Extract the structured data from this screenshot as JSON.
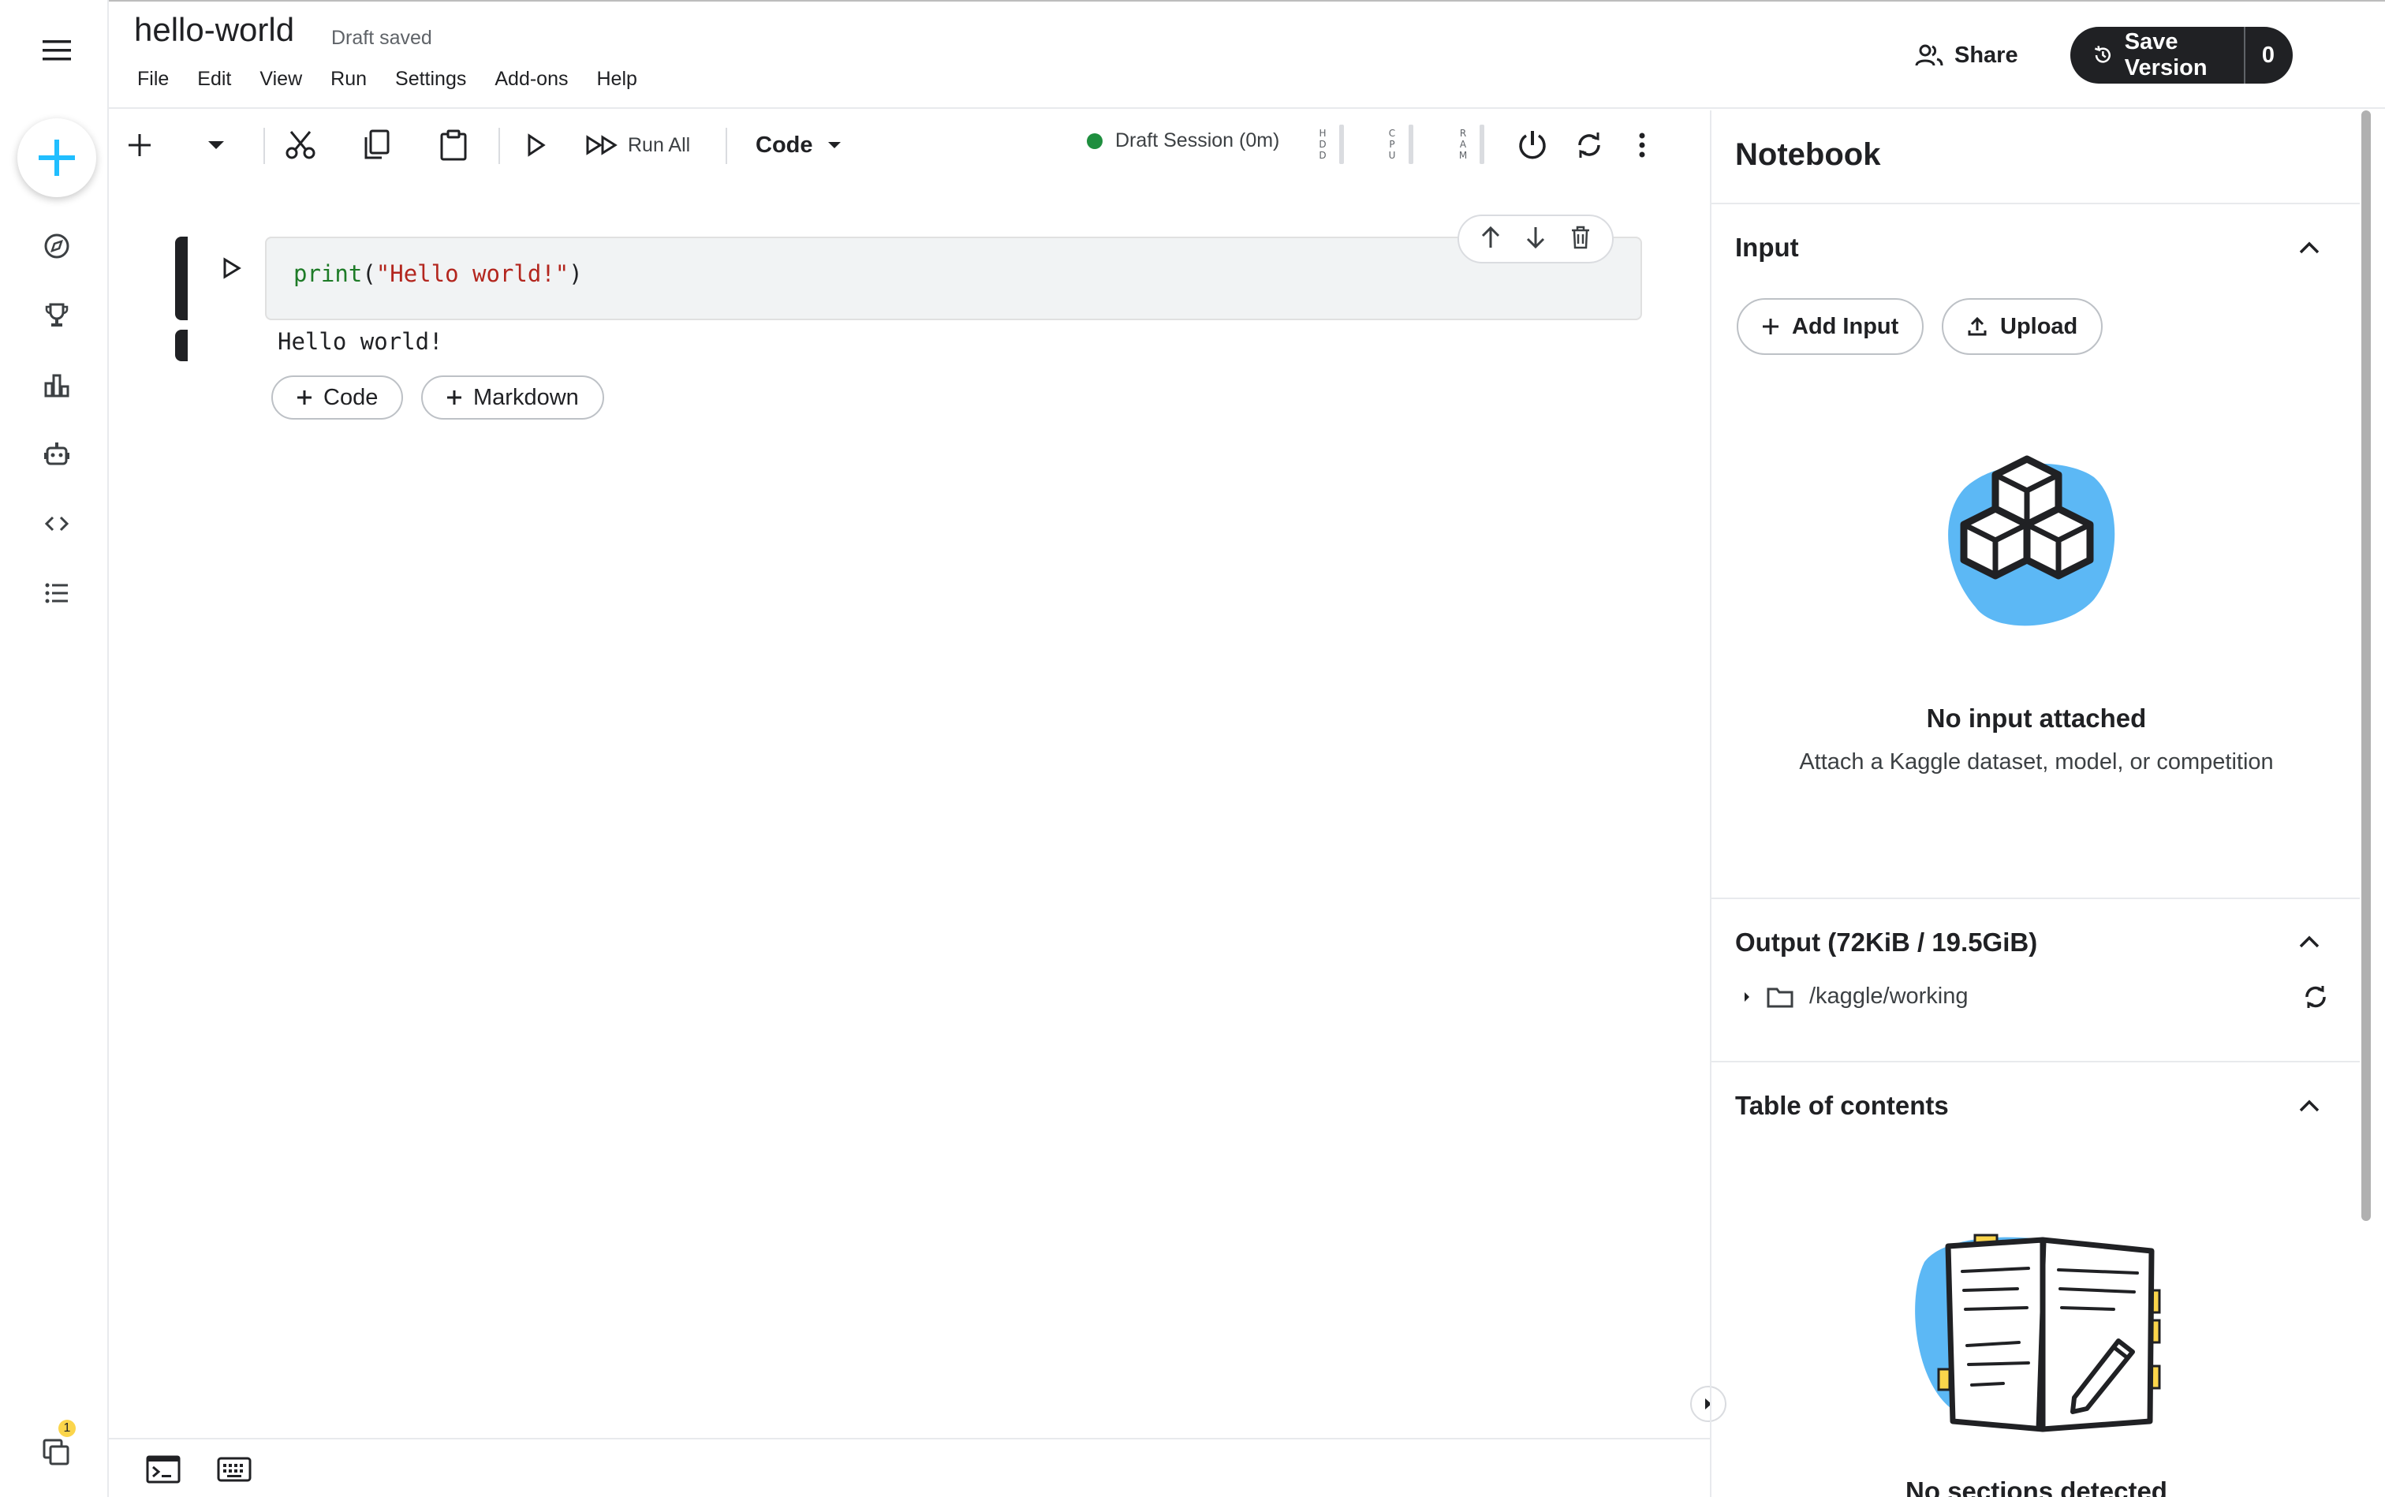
{
  "header": {
    "title": "hello-world",
    "status": "Draft saved",
    "menu": [
      "File",
      "Edit",
      "View",
      "Run",
      "Settings",
      "Add-ons",
      "Help"
    ],
    "share_label": "Share",
    "save_version_label": "Save Version",
    "save_version_count": "0"
  },
  "rail": {
    "notification_count": "1",
    "icons": [
      "menu-icon",
      "create-icon",
      "explore-icon",
      "trophy-icon",
      "bar-chart-icon",
      "robot-icon",
      "code-icon",
      "list-icon",
      "copy-stack-icon"
    ]
  },
  "toolbar": {
    "run_all_label": "Run All",
    "cell_type": "Code",
    "session_label": "Draft Session (0m)",
    "meters": [
      {
        "letters": [
          "H",
          "D",
          "D"
        ]
      },
      {
        "letters": [
          "C",
          "P",
          "U"
        ]
      },
      {
        "letters": [
          "R",
          "A",
          "M"
        ]
      }
    ]
  },
  "cell": {
    "code_func": "print",
    "code_open": "(",
    "code_string": "\"Hello world!\"",
    "code_close": ")",
    "output": "Hello world!",
    "add_code_label": "Code",
    "add_markdown_label": "Markdown"
  },
  "panel": {
    "title": "Notebook",
    "input": {
      "title": "Input",
      "add_input_label": "Add Input",
      "upload_label": "Upload",
      "empty_title": "No input attached",
      "empty_subtitle": "Attach a Kaggle dataset, model, or competition"
    },
    "output": {
      "title": "Output (72KiB / 19.5GiB)",
      "folder": "/kaggle/working"
    },
    "toc": {
      "title": "Table of contents",
      "empty_title": "No sections detected"
    }
  },
  "colors": {
    "accent_blue": "#20beff",
    "illustration_blue": "#5cb8f5",
    "dark": "#202124",
    "session_green": "#1e8e3e",
    "string_red": "#b3261e",
    "func_green": "#1e7b27",
    "badge_yellow": "#fbd54b"
  }
}
